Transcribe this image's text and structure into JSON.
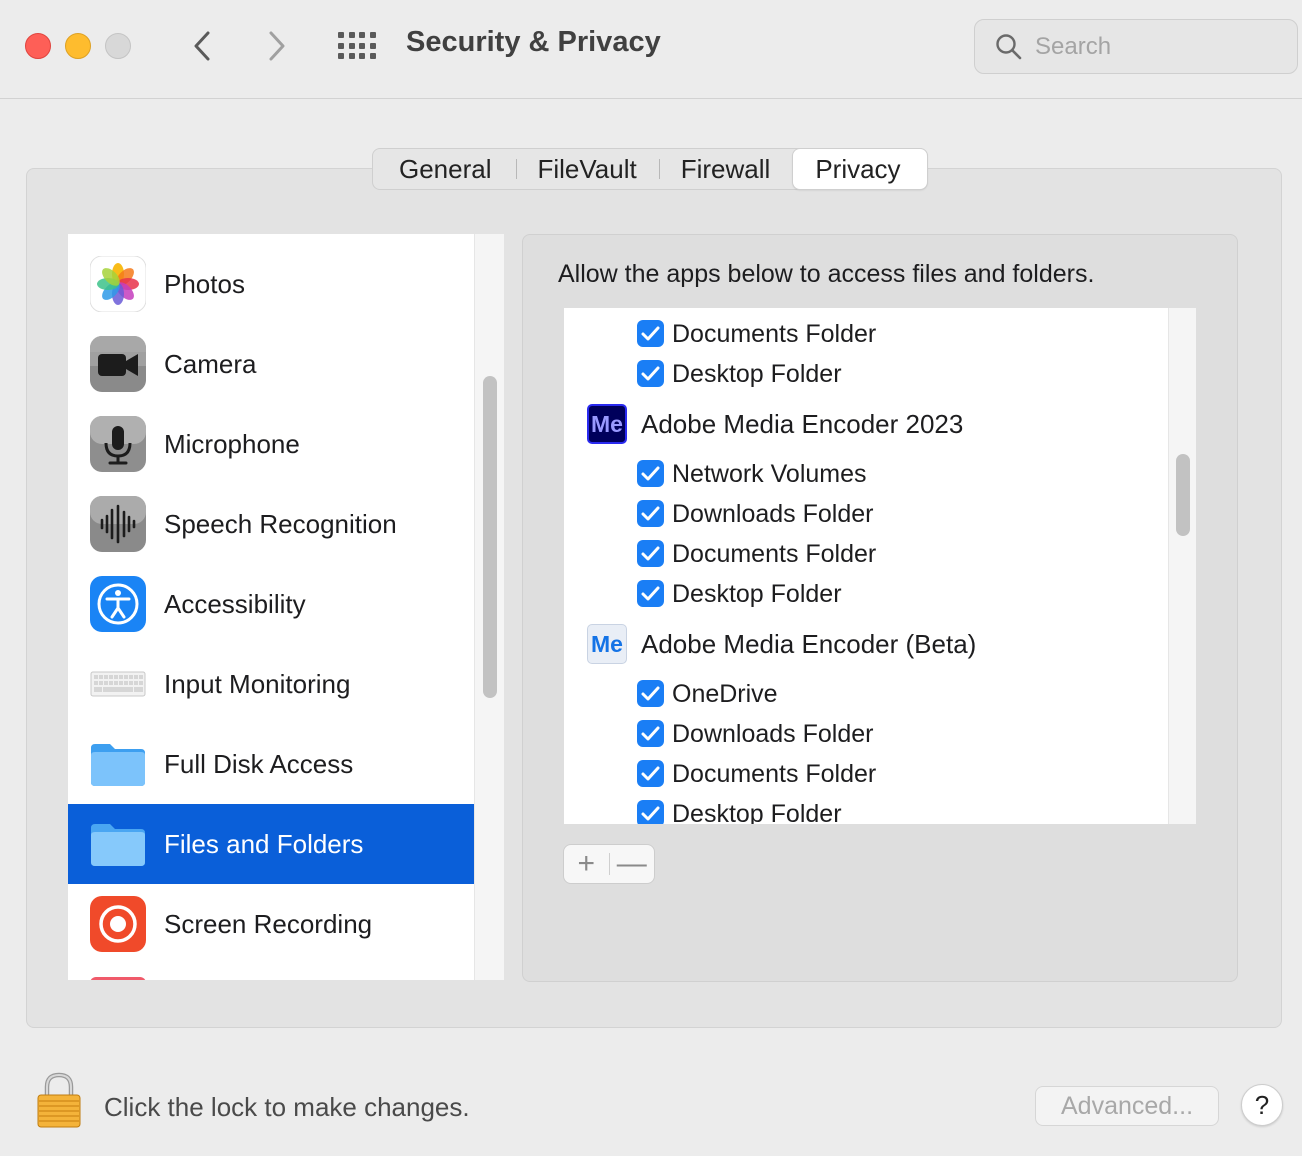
{
  "window": {
    "title": "Security & Privacy",
    "search_placeholder": "Search"
  },
  "tabs": [
    {
      "label": "General",
      "active": false
    },
    {
      "label": "FileVault",
      "active": false
    },
    {
      "label": "Firewall",
      "active": false
    },
    {
      "label": "Privacy",
      "active": true
    }
  ],
  "categories": [
    {
      "label": "Photos",
      "icon": "photos-icon"
    },
    {
      "label": "Camera",
      "icon": "camera-icon"
    },
    {
      "label": "Microphone",
      "icon": "microphone-icon"
    },
    {
      "label": "Speech Recognition",
      "icon": "speech-recognition-icon"
    },
    {
      "label": "Accessibility",
      "icon": "accessibility-icon"
    },
    {
      "label": "Input Monitoring",
      "icon": "keyboard-icon"
    },
    {
      "label": "Full Disk Access",
      "icon": "folder-icon"
    },
    {
      "label": "Files and Folders",
      "icon": "folder-icon",
      "selected": true
    },
    {
      "label": "Screen Recording",
      "icon": "screen-recording-icon"
    }
  ],
  "right_pane": {
    "description": "Allow the apps below to access files and folders.",
    "rows": [
      {
        "type": "perm",
        "label": "Documents Folder",
        "checked": true
      },
      {
        "type": "perm",
        "label": "Desktop Folder",
        "checked": true
      },
      {
        "type": "app",
        "label": "Adobe Media Encoder 2023",
        "icon_text": "Me"
      },
      {
        "type": "perm",
        "label": "Network Volumes",
        "checked": true
      },
      {
        "type": "perm",
        "label": "Downloads Folder",
        "checked": true
      },
      {
        "type": "perm",
        "label": "Documents Folder",
        "checked": true
      },
      {
        "type": "perm",
        "label": "Desktop Folder",
        "checked": true
      },
      {
        "type": "app",
        "label": "Adobe Media Encoder (Beta)",
        "icon_text": "Me"
      },
      {
        "type": "perm",
        "label": "OneDrive",
        "checked": true
      },
      {
        "type": "perm",
        "label": "Downloads Folder",
        "checked": true
      },
      {
        "type": "perm",
        "label": "Documents Folder",
        "checked": true
      },
      {
        "type": "perm",
        "label": "Desktop Folder",
        "checked": true
      }
    ],
    "add_label": "+",
    "remove_label": "—"
  },
  "footer": {
    "lock_text": "Click the lock to make changes.",
    "advanced_label": "Advanced...",
    "help_label": "?"
  },
  "colors": {
    "selection": "#0a5fd9",
    "checkbox": "#1a7ef5",
    "close": "#fe5f57",
    "minimize": "#febc2e"
  }
}
